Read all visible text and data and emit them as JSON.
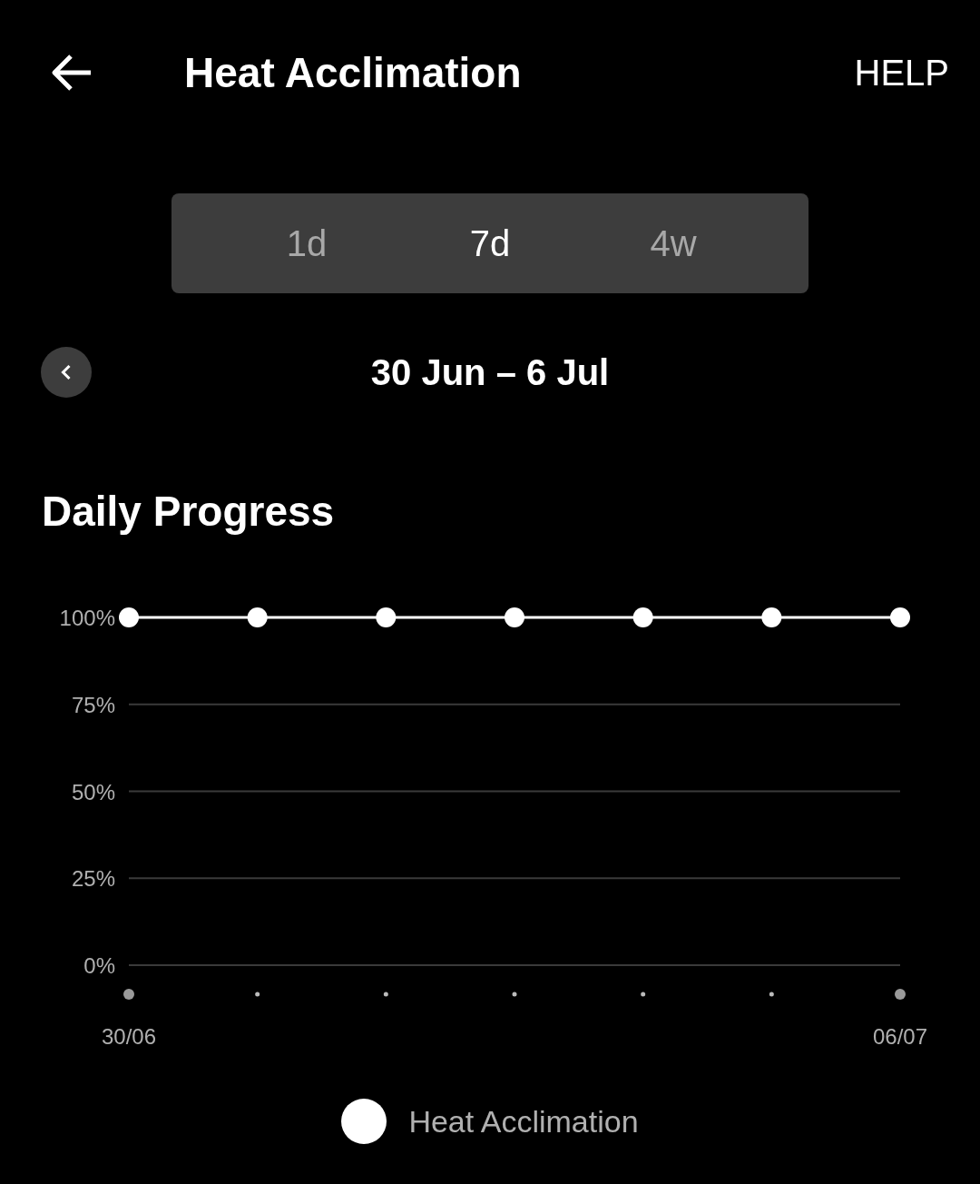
{
  "header": {
    "title": "Heat Acclimation",
    "help": "HELP"
  },
  "range_tabs": [
    {
      "label": "1d",
      "selected": false
    },
    {
      "label": "7d",
      "selected": true
    },
    {
      "label": "4w",
      "selected": false
    }
  ],
  "date_range": {
    "label": "30 Jun – 6 Jul"
  },
  "daily_progress": {
    "title": "Daily Progress",
    "chart_data": {
      "type": "line",
      "categories": [
        "30/06",
        null,
        null,
        null,
        null,
        null,
        "06/07"
      ],
      "series": [
        {
          "name": "Heat Acclimation",
          "color": "#ffffff",
          "marker": "circle",
          "values": [
            100,
            100,
            100,
            100,
            100,
            100,
            100
          ]
        }
      ],
      "ylim": [
        0,
        100
      ],
      "grid": true,
      "yticks": [
        {
          "value": 0,
          "label": "0%"
        },
        {
          "value": 25,
          "label": "25%"
        },
        {
          "value": 50,
          "label": "50%"
        },
        {
          "value": 75,
          "label": "75%"
        },
        {
          "value": 100,
          "label": "100%"
        }
      ]
    }
  }
}
